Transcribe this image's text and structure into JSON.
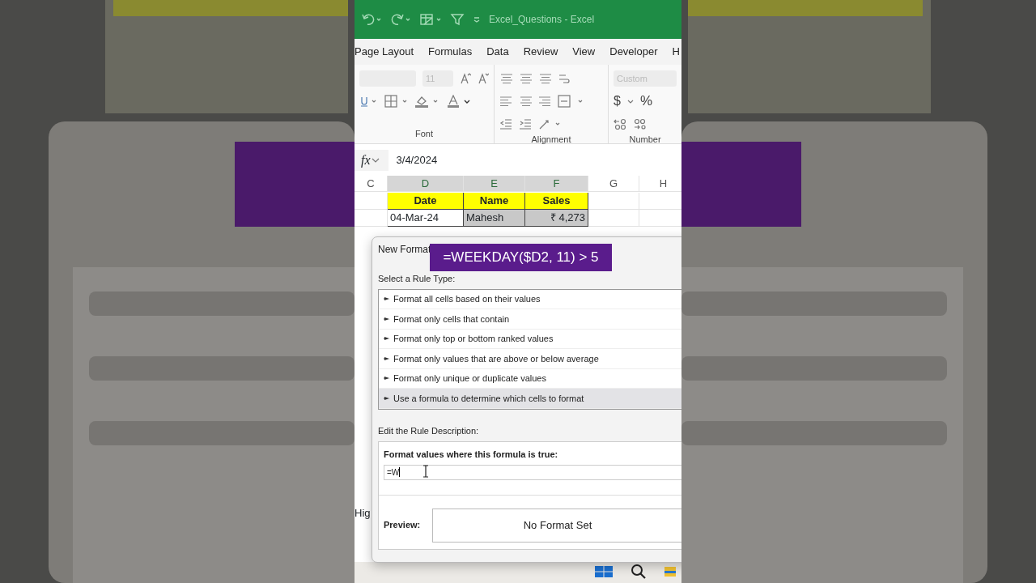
{
  "title_bar": {
    "title": "Excel_Questions  -  Excel"
  },
  "ribbon_tabs": [
    {
      "label": "Page Layout"
    },
    {
      "label": "Formulas"
    },
    {
      "label": "Data"
    },
    {
      "label": "Review"
    },
    {
      "label": "View"
    },
    {
      "label": "Developer"
    },
    {
      "label": "H"
    }
  ],
  "ribbon": {
    "font_size": "11",
    "number_format": "Custom",
    "currency": "$",
    "percent": "%",
    "groups": [
      "Font",
      "Alignment",
      "Number"
    ]
  },
  "formula_bar": {
    "fx": "fx",
    "value": "3/4/2024"
  },
  "sheet": {
    "columns": [
      "C",
      "D",
      "E",
      "F",
      "G",
      "H"
    ],
    "rows": [
      [
        "",
        "Date",
        "Name",
        "Sales",
        "",
        ""
      ],
      [
        "",
        "04-Mar-24",
        "Mahesh",
        "₹ 4,273",
        "",
        ""
      ]
    ],
    "side_label": "Hig"
  },
  "dialog": {
    "title": "New Format",
    "rule_type_label": "Select a Rule Type:",
    "rule_types": [
      {
        "label": "Format all cells based on their values",
        "selected": false
      },
      {
        "label": "Format only cells that contain",
        "selected": false
      },
      {
        "label": "Format only top or bottom ranked values",
        "selected": false
      },
      {
        "label": "Format only values that are above or below average",
        "selected": false
      },
      {
        "label": "Format only unique or duplicate values",
        "selected": false
      },
      {
        "label": "Use a formula to determine which cells to format",
        "selected": true
      }
    ],
    "description_label": "Edit the Rule Description:",
    "formula_label": "Format values where this formula is true:",
    "formula_value": "=W",
    "preview_label": "Preview:",
    "preview_text": "No Format Set"
  },
  "overlay": {
    "text": "=WEEKDAY($D2, 11) > 5"
  }
}
